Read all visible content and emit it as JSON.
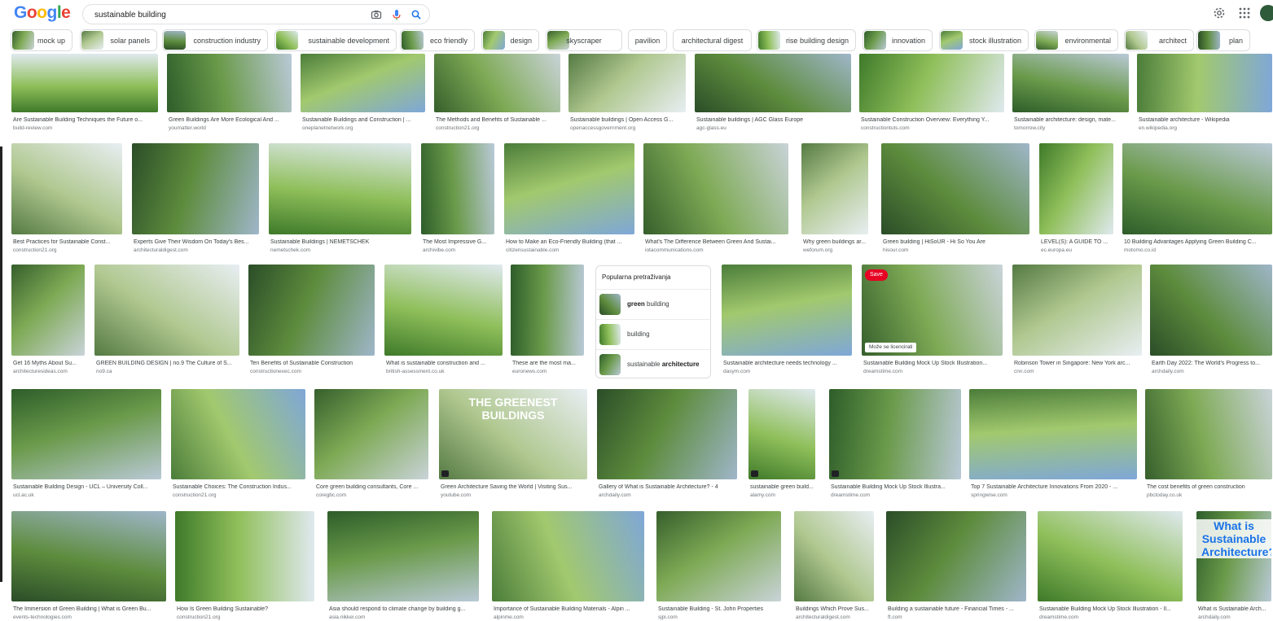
{
  "header": {
    "logo_letters": [
      {
        "ch": "G",
        "color": "#4285f4"
      },
      {
        "ch": "o",
        "color": "#ea4335"
      },
      {
        "ch": "o",
        "color": "#fbbc05"
      },
      {
        "ch": "g",
        "color": "#4285f4"
      },
      {
        "ch": "l",
        "color": "#34a853"
      },
      {
        "ch": "e",
        "color": "#ea4335"
      }
    ],
    "query": "sustainable building",
    "icons": [
      "camera-icon",
      "mic-icon",
      "search-icon",
      "settings-icon",
      "apps-icon",
      "account-avatar"
    ]
  },
  "chips": [
    "mock up",
    "solar panels",
    "construction industry",
    "sustainable development",
    "eco friendly",
    "design",
    "skyscraper",
    "pavilion",
    "architectural digest",
    "rise building design",
    "innovation",
    "stock illustration",
    "environmental",
    "architect",
    "plan"
  ],
  "popular": {
    "heading": "Popularna pretraživanja",
    "items": [
      {
        "bold": "green",
        "rest": " building"
      },
      {
        "bold": "",
        "rest": "building"
      },
      {
        "bold": "",
        "rest": "sustainable ",
        "bold_after": "architecture"
      }
    ]
  },
  "image_overlays": {
    "save": "Save",
    "license": "Može se licencirati"
  },
  "rows": [
    [
      {
        "title": "Are Sustainable Building Techniques the Future o...",
        "source": "build-review.com"
      },
      {
        "title": "Green Buildings Are More Ecological And ...",
        "source": "youmatter.world"
      },
      {
        "title": "Sustainable Buildings and Construction | ...",
        "source": "oneplanetnetwork.org"
      },
      {
        "title": "The Methods and Benefits of Sustainable ...",
        "source": "construction21.org"
      },
      {
        "title": "Sustainable buildings | Open Access G...",
        "source": "openaccessgovernment.org"
      },
      {
        "title": "Sustainable buildings | AGC Glass Europe",
        "source": "agc-glass.eu"
      },
      {
        "title": "Sustainable Construction Overview: Everything Y...",
        "source": "constructiontuts.com"
      },
      {
        "title": "Sustainable architecture: design, mate...",
        "source": "tomorrow.city"
      },
      {
        "title": "Sustainable architecture - Wikipedia",
        "source": "en.wikipedia.org"
      }
    ],
    [
      {
        "title": "Best Practices for Sustainable Const...",
        "source": "construction21.org"
      },
      {
        "title": "Experts Give Their Wisdom On Today's Bes...",
        "source": "architecturaldigest.com"
      },
      {
        "title": "Sustainable Buildings | NEMETSCHEK",
        "source": "nemetschek.com"
      },
      {
        "title": "The Most Impressive G...",
        "source": "archivibe.com"
      },
      {
        "title": "How to Make an Eco-Friendly Building (that ...",
        "source": "citizensustainable.com"
      },
      {
        "title": "What's The Difference Between Green And Sustai...",
        "source": "iotacommunications.com"
      },
      {
        "title": "Why green buildings ar...",
        "source": "weforum.org"
      },
      {
        "title": "Green building | HiSoUR - Hi So You Are",
        "source": "hisour.com"
      },
      {
        "title": "LEVEL(S): A GUIDE TO ...",
        "source": "ec.europa.eu"
      },
      {
        "title": "10 Building Advantages Applying Green Building C...",
        "source": "motomo.co.id"
      }
    ],
    [
      {
        "title": "Get 16 Myths About Su...",
        "source": "architecturesideas.com"
      },
      {
        "title": "GREEN BUILDING DESIGN | no.9 The Culture of S...",
        "source": "no9.ca"
      },
      {
        "title": "Ten Benefits of Sustainable Construction",
        "source": "constructionexec.com"
      },
      {
        "title": "What is sustainable construction and ...",
        "source": "british-assessment.co.uk"
      },
      {
        "title": "These are the most ma...",
        "source": "euronews.com"
      },
      {
        "title": "Sustainable architecture needs technology ...",
        "source": "dasym.com"
      },
      {
        "title": "Sustainable Building Mock Up Stock Illustration...",
        "source": "dreamstime.com"
      },
      {
        "title": "Robinson Tower in Singapore: New York arc...",
        "source": "cnn.com"
      },
      {
        "title": "Earth Day 2022: The World's Progress to...",
        "source": "archdaily.com"
      }
    ],
    [
      {
        "title": "Sustainable Building Design - UCL – University Coll...",
        "source": "ucl.ac.uk"
      },
      {
        "title": "Sustainable Choices: The Construction Indus...",
        "source": "construction21.org"
      },
      {
        "title": "Core green building consultants, Core ...",
        "source": "coregbc.com"
      },
      {
        "title": "Green Architecture Saving the World | Visiting Sus...",
        "source": "youtube.com",
        "overlay": "THE GREENEST BUILDINGS"
      },
      {
        "title": "Gallery of What is Sustainable Architecture? - 4",
        "source": "archdaily.com"
      },
      {
        "title": "sustainable green build...",
        "source": "alamy.com"
      },
      {
        "title": "Sustainable Building Mock Up Stock Illustra...",
        "source": "dreamstime.com"
      },
      {
        "title": "Top 7 Sustainable Architecture Innovations From 2020 - ...",
        "source": "springwise.com"
      },
      {
        "title": "The cost benefits of green construction",
        "source": "pbctoday.co.uk"
      }
    ],
    [
      {
        "title": "The Immersion of Green Building | What is Green Bu...",
        "source": "events-technologies.com"
      },
      {
        "title": "How Is Green Building Sustainable?",
        "source": "construction21.org"
      },
      {
        "title": "Asia should respond to climate change by building g...",
        "source": "asia.nikkei.com"
      },
      {
        "title": "Importance of Sustainable Building Materials - Alpin ...",
        "source": "alpinme.com"
      },
      {
        "title": "Sustainable Building - St. John Properties",
        "source": "sjpi.com"
      },
      {
        "title": "Buildings Which Prove Sus...",
        "source": "architecturaldigest.com"
      },
      {
        "title": "Building a sustainable future - Financial Times - ...",
        "source": "ft.com"
      },
      {
        "title": "Sustainable Building Mock Up Stock Illustration - Il...",
        "source": "dreamstime.com"
      },
      {
        "title": "What is Sustainable Arch...",
        "source": "archdaily.com",
        "overlay": "What is Sustainable Architecture?"
      }
    ]
  ],
  "colors": {
    "accent": "#1a73e8",
    "save_red": "#e60023",
    "chip_border": "#dadce0",
    "muted": "#70757a"
  }
}
